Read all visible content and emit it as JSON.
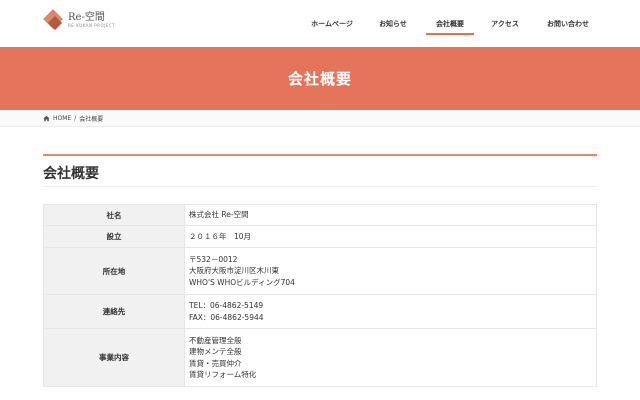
{
  "logo": {
    "name": "Re-空間",
    "sub": "RE-KUKAN PROJECT"
  },
  "nav": [
    {
      "label": "ホームページ",
      "active": false
    },
    {
      "label": "お知らせ",
      "active": false
    },
    {
      "label": "会社概要",
      "active": true
    },
    {
      "label": "アクセス",
      "active": false
    },
    {
      "label": "お問い合わせ",
      "active": false
    }
  ],
  "banner": {
    "title": "会社概要"
  },
  "breadcrumb": {
    "home": "HOME",
    "sep": "/",
    "current": "会社概要"
  },
  "section": {
    "title": "会社概要"
  },
  "table": [
    {
      "label": "社名",
      "lines": [
        "株式会社 Re-空間"
      ]
    },
    {
      "label": "設立",
      "lines": [
        "２０１６年　10月"
      ]
    },
    {
      "label": "所在地",
      "lines": [
        "〒532－0012",
        "大阪府大阪市淀川区木川東",
        "WHO'S WHOビルディング704"
      ]
    },
    {
      "label": "連絡先",
      "lines": [
        "TEL：06-4862-5149",
        "FAX：06-4862-5944"
      ]
    },
    {
      "label": "事業内容",
      "lines": [
        "不動産管理全般",
        "建物メンテ全般",
        "賃貸・売買仲介",
        "賃貸リフォーム特化"
      ]
    }
  ],
  "colors": {
    "accent": "#e4745a",
    "rule": "#e9866c"
  }
}
